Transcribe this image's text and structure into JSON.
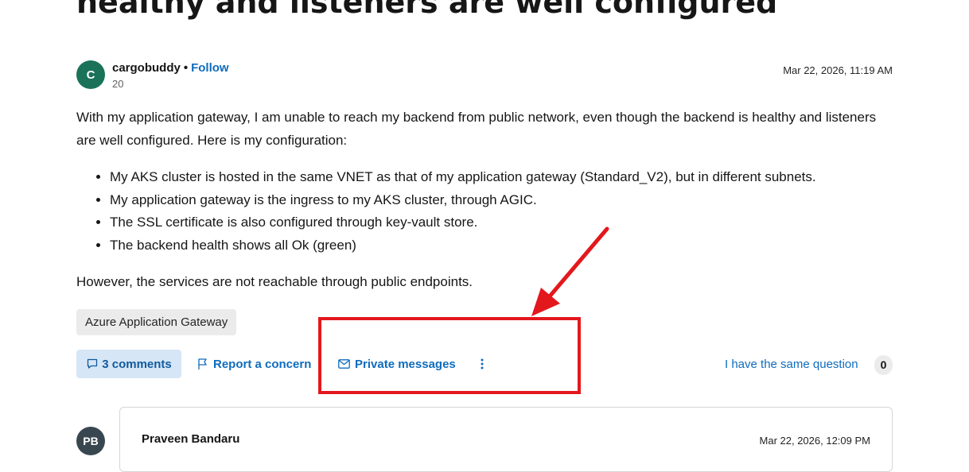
{
  "question": {
    "title_visible_line": "healthy and listeners are well configured",
    "author": {
      "initial": "C",
      "name": "cargobuddy",
      "separator": "•",
      "follow_label": "Follow",
      "reputation": "20"
    },
    "date": "Mar 22, 2026, 11:19 AM",
    "body_intro": "With my application gateway, I am unable to reach my backend from public network, even though the backend is healthy and listeners are well configured. Here is my configuration:",
    "bullets": [
      "My AKS cluster is hosted in the same VNET as that of my application gateway (Standard_V2), but in different subnets.",
      "My application gateway is the ingress to my AKS cluster, through AGIC.",
      "The SSL certificate is also configured through key-vault store.",
      "The backend health shows all Ok (green)"
    ],
    "body_closing": "However, the services are not reachable through public endpoints.",
    "tag": "Azure Application Gateway"
  },
  "actions": {
    "comments_label": "3 comments",
    "report_label": "Report a concern",
    "private_messages_label": "Private messages",
    "more_icon": "more-vertical-icon",
    "same_question_label": "I have the same question",
    "same_question_count": "0"
  },
  "comment": {
    "avatar_initials": "PB",
    "author": "Praveen Bandaru",
    "date": "Mar 22, 2026, 12:09 PM"
  },
  "annotation": {
    "color": "#e3181d"
  },
  "colors": {
    "link": "#0f6cbd",
    "avatar": "#1a7258",
    "comments_bg": "#d6e6f6"
  }
}
